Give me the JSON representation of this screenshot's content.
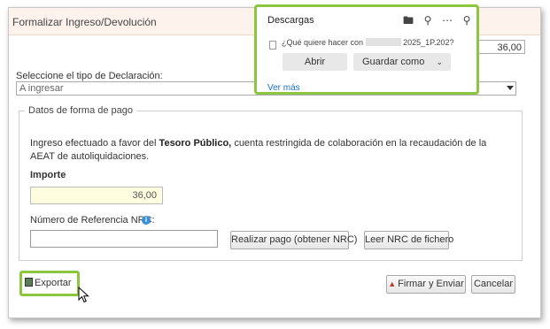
{
  "dialog": {
    "title": "Formalizar Ingreso/Devolución",
    "amount_top": "36,00",
    "declaration_label": "Seleccione el tipo de Declaración:",
    "declaration_value": "A ingresar",
    "payment_legend": "Datos de forma de pago",
    "payment_text_prefix": "Ingreso efectuado a favor del",
    "payment_text_bold": "Tesoro Público,",
    "payment_text_suffix": "cuenta restringida de colaboración en la recaudación de la AEAT de autoliquidaciones.",
    "importe_label": "Importe",
    "importe_value": "36,00",
    "nrc_label": "Número de Referencia  NRC:",
    "nrc_value": "",
    "btn_realizar_pago": "Realizar pago (obtener NRC)",
    "btn_leer_nrc": "Leer NRC de fichero",
    "btn_exportar": "Exportar",
    "btn_firmar": "Firmar y Enviar",
    "btn_cancelar": "Cancelar"
  },
  "downloads": {
    "title": "Descargas",
    "question_prefix": "¿Qué quiere hacer con",
    "question_suffix": "2025_1P.202?",
    "btn_abrir": "Abrir",
    "btn_guardar": "Guardar como",
    "ver_mas": "Ver más",
    "icons": [
      "folder-icon",
      "search-icon",
      "more-icon",
      "pin-icon"
    ]
  },
  "colors": {
    "highlight": "#8cc63f",
    "titlebar_bg": "#fdf3ec",
    "importe_bg": "#fffde0",
    "link": "#1a6fc9"
  }
}
